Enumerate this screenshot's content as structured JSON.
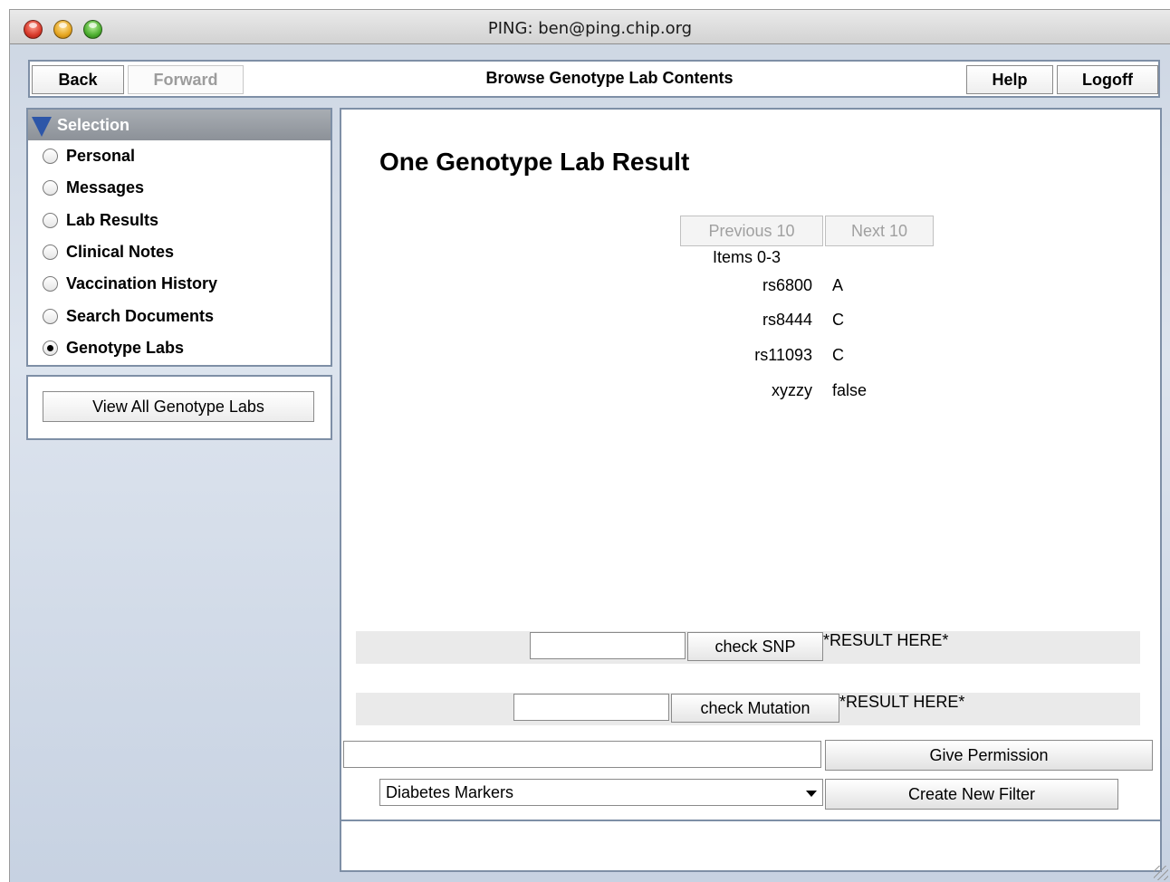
{
  "window": {
    "title": "PING: ben@ping.chip.org"
  },
  "toolbar": {
    "back_label": "Back",
    "forward_label": "Forward",
    "page_title": "Browse Genotype Lab Contents",
    "help_label": "Help",
    "logoff_label": "Logoff"
  },
  "selection": {
    "header": "Selection",
    "items": [
      {
        "label": "Personal",
        "checked": false
      },
      {
        "label": "Messages",
        "checked": false
      },
      {
        "label": "Lab Results",
        "checked": false
      },
      {
        "label": "Clinical Notes",
        "checked": false
      },
      {
        "label": "Vaccination History",
        "checked": false
      },
      {
        "label": "Search Documents",
        "checked": false
      },
      {
        "label": "Genotype Labs",
        "checked": true
      }
    ],
    "view_all_label": "View All Genotype Labs"
  },
  "main": {
    "title": "One Genotype Lab Result",
    "prev_label": "Previous 10",
    "next_label": "Next 10",
    "items_range": "Items 0-3",
    "rows": [
      {
        "key": "rs6800",
        "value": "A"
      },
      {
        "key": "rs8444",
        "value": "C"
      },
      {
        "key": "rs11093",
        "value": "C"
      },
      {
        "key": "xyzzy",
        "value": "false"
      }
    ],
    "check_snp": {
      "input_value": "",
      "button_label": "check SNP",
      "result": "*RESULT HERE*"
    },
    "check_mutation": {
      "input_value": "",
      "button_label": "check Mutation",
      "result": "*RESULT HERE*"
    },
    "permission": {
      "input_value": "",
      "button_label": "Give Permission"
    },
    "filter": {
      "selected": "Diabetes Markers",
      "button_label": "Create New Filter"
    }
  }
}
